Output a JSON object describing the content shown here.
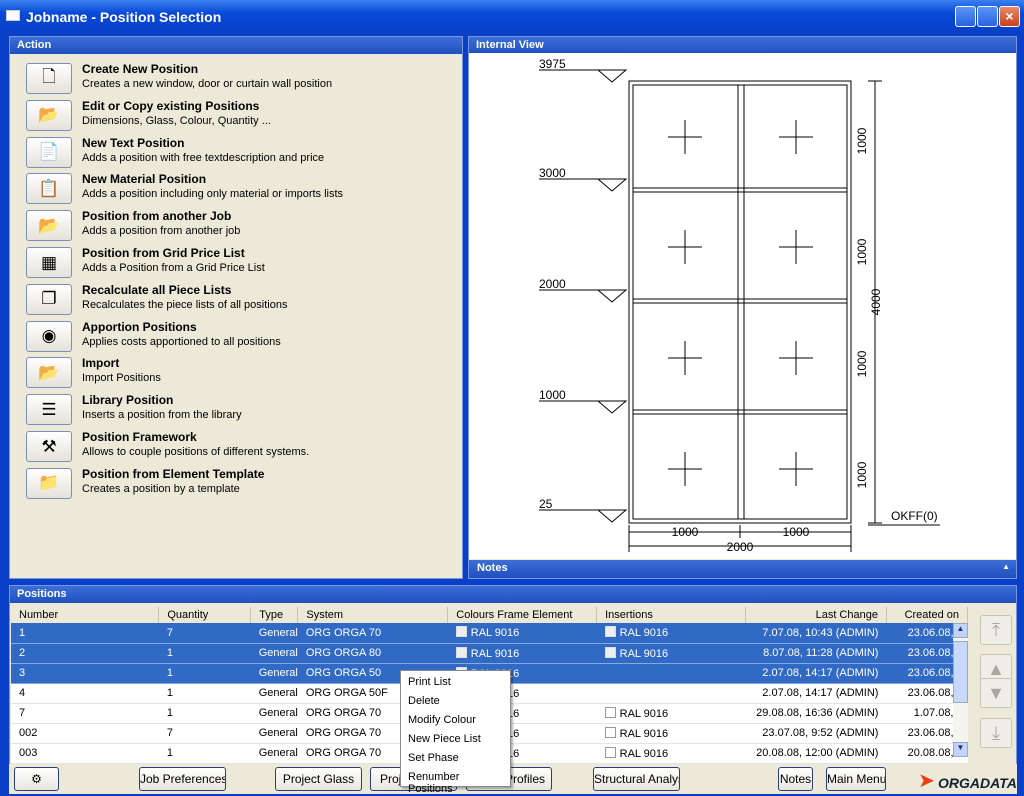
{
  "window": {
    "title": "Jobname - Position Selection"
  },
  "action": {
    "header": "Action",
    "items": [
      {
        "title": "Create New Position",
        "desc": "Creates a new window, door or curtain wall position",
        "icon": "page-icon"
      },
      {
        "title": "Edit or Copy existing Positions",
        "desc": "Dimensions, Glass, Colour, Quantity ...",
        "icon": "edit-copy-icon"
      },
      {
        "title": "New Text Position",
        "desc": "Adds a position with free textdescription and price",
        "icon": "text-document-icon"
      },
      {
        "title": "New Material Position",
        "desc": "Adds a position including only material or imports lists",
        "icon": "material-list-icon"
      },
      {
        "title": "Position from another Job",
        "desc": "Adds a position from another job",
        "icon": "open-folder-icon"
      },
      {
        "title": "Position from Grid Price List",
        "desc": "Adds a Position from a Grid Price List",
        "icon": "grid-icon"
      },
      {
        "title": "Recalculate all Piece Lists",
        "desc": "Recalculates the piece lists of all positions",
        "icon": "copies-icon"
      },
      {
        "title": "Apportion Positions",
        "desc": "Applies costs apportioned to all positions",
        "icon": "coins-icon"
      },
      {
        "title": "Import",
        "desc": "Import Positions",
        "icon": "import-folder-icon"
      },
      {
        "title": "Library Position",
        "desc": "Inserts a position from the library",
        "icon": "library-icon"
      },
      {
        "title": "Position Framework",
        "desc": "Allows to couple positions of different systems.",
        "icon": "tools-icon"
      },
      {
        "title": "Position from Element Template",
        "desc": "Creates a position by a template",
        "icon": "template-icon"
      }
    ]
  },
  "internal_view": {
    "header": "Internal View",
    "levels": [
      "3975",
      "3000",
      "2000",
      "1000",
      "25"
    ],
    "vertical_dims": [
      "1000",
      "1000",
      "1000",
      "1000"
    ],
    "total_height": "4000",
    "horizontal_dims": [
      "1000",
      "1000"
    ],
    "total_width": "2000",
    "floor_label": "OKFF(0)"
  },
  "notes": {
    "header": "Notes"
  },
  "positions": {
    "header": "Positions",
    "columns": [
      "Number",
      "Quantity",
      "Type",
      "System",
      "Colours Frame Element",
      "Insertions",
      "Last Change",
      "Created on"
    ],
    "rows": [
      {
        "number": "1",
        "quantity": "7",
        "type": "General",
        "system": "ORG ORGA 70",
        "colour": "RAL 9016",
        "insertion": "RAL 9016",
        "last_change": "7.07.08, 10:43 (ADMIN)",
        "created": "23.06.08,",
        "selected": true
      },
      {
        "number": "2",
        "quantity": "1",
        "type": "General",
        "system": "ORG ORGA 80",
        "colour": "RAL 9016",
        "insertion": "RAL 9016",
        "last_change": "8.07.08, 11:28 (ADMIN)",
        "created": "23.06.08,",
        "selected": true
      },
      {
        "number": "3",
        "quantity": "1",
        "type": "General",
        "system": "ORG ORGA 50",
        "colour": "RAL 9016",
        "insertion": "",
        "last_change": "2.07.08, 14:17 (ADMIN)",
        "created": "23.06.08,",
        "selected": true
      },
      {
        "number": "4",
        "quantity": "1",
        "type": "General",
        "system": "ORG ORGA 50F",
        "colour": "RAL 9016",
        "insertion": "",
        "last_change": "2.07.08, 14:17 (ADMIN)",
        "created": "23.06.08,",
        "selected": false
      },
      {
        "number": "7",
        "quantity": "1",
        "type": "General",
        "system": "ORG ORGA 70",
        "colour": "RAL 9016",
        "insertion": "RAL 9016",
        "last_change": "29.08.08, 16:36 (ADMIN)",
        "created": "1.07.08,",
        "selected": false
      },
      {
        "number": "002",
        "quantity": "7",
        "type": "General",
        "system": "ORG ORGA 70",
        "colour": "RAL 9016",
        "insertion": "RAL 9016",
        "last_change": "23.07.08,  9:52 (ADMIN)",
        "created": "23.06.08,",
        "selected": false
      },
      {
        "number": "003",
        "quantity": "1",
        "type": "General",
        "system": "ORG ORGA 70",
        "colour": "RAL 9016",
        "insertion": "RAL 9016",
        "last_change": "20.08.08, 12:00 (ADMIN)",
        "created": "20.08.08,",
        "selected": false
      }
    ]
  },
  "context_menu": [
    "Print List",
    "Delete",
    "Modify Colour",
    "New Piece List",
    "Set Phase",
    "Renumber Positions"
  ],
  "buttons": {
    "job_preferences": "Job Preferences",
    "project_glass": "Project Glass",
    "project_partial": "Proj",
    "profiles": "Profiles",
    "structural": "Structural Analysis",
    "notes": "Notes",
    "main_menu": "Main Menu"
  },
  "logo": "ORGADATA",
  "colors": {
    "selection": "#316ac5",
    "header": "#1e4fbf",
    "frame": "#0a3fc8"
  }
}
